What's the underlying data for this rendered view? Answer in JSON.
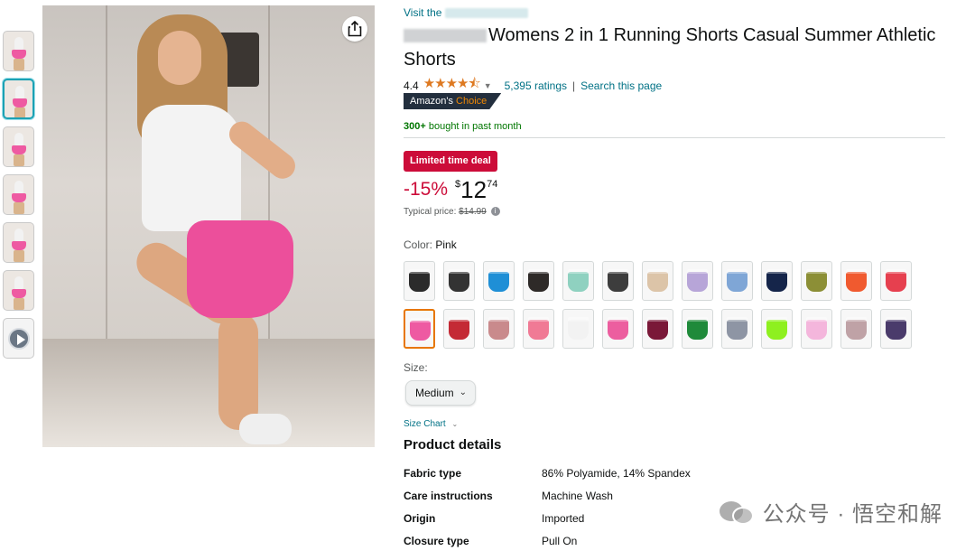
{
  "thumbnails": [
    {
      "kind": "image",
      "color": "#ee5aa2",
      "selected": false
    },
    {
      "kind": "image",
      "color": "#ee5aa2",
      "selected": true
    },
    {
      "kind": "image",
      "color": "#ee5aa2",
      "selected": false
    },
    {
      "kind": "image",
      "color": "#ee5aa2",
      "selected": false
    },
    {
      "kind": "image",
      "color": "#ee5aa2",
      "selected": false
    },
    {
      "kind": "image",
      "color": "#ee5aa2",
      "selected": false
    },
    {
      "kind": "video",
      "icon": "play-icon",
      "selected": false
    }
  ],
  "main_image": {
    "shorts_color": "#ec4f9b",
    "share_icon": "share-icon"
  },
  "product": {
    "store_prefix": "Visit the",
    "title": "Womens 2 in 1 Running Shorts Casual Summer Athletic Shorts",
    "rating": "4.4",
    "stars": "★★★★⯪",
    "ratings_count": "5,395 ratings",
    "search_link": "Search this page",
    "choice_prefix": "Amazon's",
    "choice_suffix": "Choice",
    "bought_count": "300+",
    "bought_text": "bought in past month",
    "deal_badge": "Limited time deal",
    "discount": "-15%",
    "currency": "$",
    "price_whole": "12",
    "price_fraction": "74",
    "typical_label": "Typical price:",
    "typical_price": "$14.99",
    "color_label": "Color:",
    "color_value": "Pink",
    "size_label": "Size:",
    "size_value": "Medium",
    "size_chart": "Size Chart",
    "details_title": "Product details"
  },
  "swatches": [
    {
      "color": "#2b2b2b",
      "selected": false
    },
    {
      "color": "#333333",
      "selected": false
    },
    {
      "color": "#1f8fd6",
      "selected": false
    },
    {
      "color": "#2e2a28",
      "selected": false
    },
    {
      "color": "#8fd1c0",
      "selected": false
    },
    {
      "color": "#3d3d3d",
      "selected": false
    },
    {
      "color": "#dcc4a8",
      "selected": false
    },
    {
      "color": "#b7a5d8",
      "selected": false
    },
    {
      "color": "#7fa6d6",
      "selected": false
    },
    {
      "color": "#15254a",
      "selected": false
    },
    {
      "color": "#8c8f36",
      "selected": false
    },
    {
      "color": "#f05a2f",
      "selected": false
    },
    {
      "color": "#e6404f",
      "selected": false
    },
    {
      "color": "#ee5aa2",
      "selected": true
    },
    {
      "color": "#c42a35",
      "selected": false
    },
    {
      "color": "#c98a8c",
      "selected": false
    },
    {
      "color": "#f07a95",
      "selected": false
    },
    {
      "color": "#f2f2f2",
      "selected": false
    },
    {
      "color": "#ec5e9f",
      "selected": false
    },
    {
      "color": "#7a1838",
      "selected": false
    },
    {
      "color": "#1f8a3a",
      "selected": false
    },
    {
      "color": "#8e95a4",
      "selected": false
    },
    {
      "color": "#8ef01f",
      "selected": false
    },
    {
      "color": "#f4b6dc",
      "selected": false
    },
    {
      "color": "#bfa2a6",
      "selected": false
    },
    {
      "color": "#4a3b6b",
      "selected": false
    }
  ],
  "details": [
    {
      "key": "Fabric type",
      "value": "86% Polyamide, 14% Spandex"
    },
    {
      "key": "Care instructions",
      "value": "Machine Wash"
    },
    {
      "key": "Origin",
      "value": "Imported"
    },
    {
      "key": "Closure type",
      "value": "Pull On"
    }
  ],
  "watermark": {
    "text": "公众号 · 悟空和解",
    "icon": "wechat-icon"
  }
}
